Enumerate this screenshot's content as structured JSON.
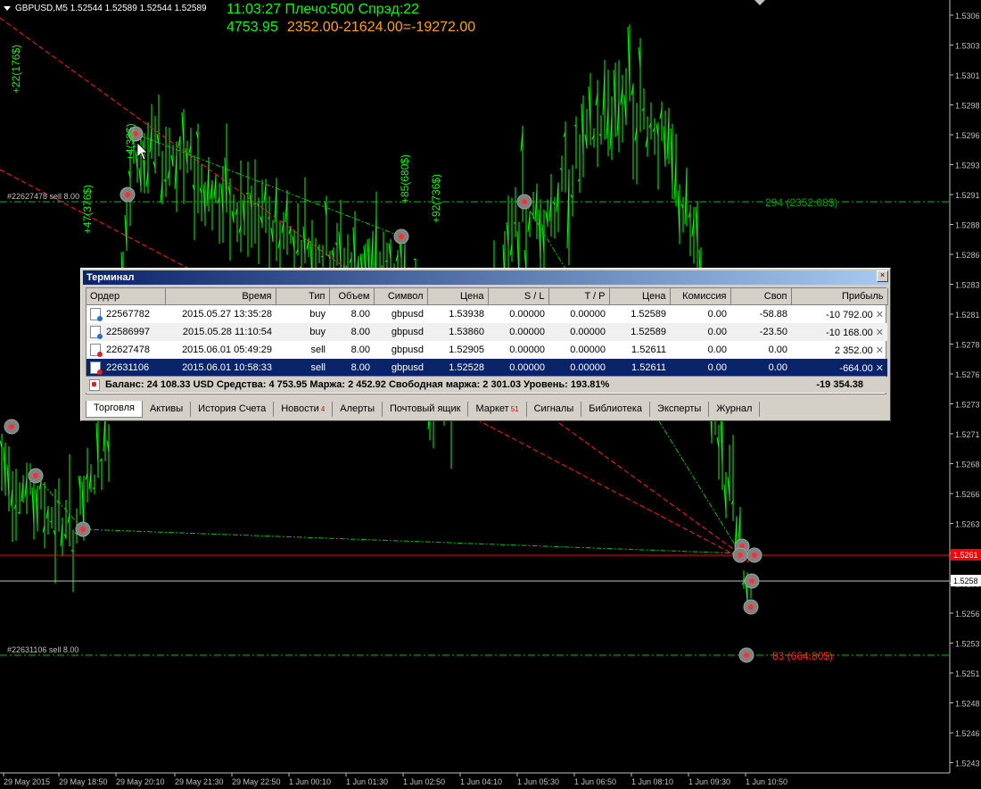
{
  "header": {
    "symbol": "GBPUSD,M5  1.52544 1.52589 1.52544 1.52589",
    "info_line1": "11:03:27 Плечо:500 Спрэд:22",
    "equity": "4753.95",
    "calc": "2352.00-21624.00=-19272.00"
  },
  "chart": {
    "price_labels": [
      "1.5306",
      "1.5303",
      "1.5301",
      "1.5298",
      "1.5296",
      "1.5293",
      "1.5291",
      "1.5288",
      "1.5286",
      "1.5283",
      "1.5281",
      "1.5278",
      "1.5276",
      "1.5273",
      "1.5271",
      "1.5268",
      "1.5266",
      "1.5263",
      "1.5261",
      "1.5258",
      "1.5256",
      "1.5253",
      "1.5251",
      "1.5248",
      "1.5246",
      "1.5243"
    ],
    "time_labels": [
      "29 May 2015",
      "29 May 18:50",
      "29 May 20:10",
      "29 May 21:30",
      "29 May 22:50",
      "1 Jun 00:10",
      "1 Jun 01:30",
      "1 Jun 02:50",
      "1 Jun 04:10",
      "1 Jun 05:30",
      "1 Jun 06:50",
      "1 Jun 08:10",
      "1 Jun 09:30",
      "1 Jun 10:50"
    ],
    "ask_label": "1.5261",
    "bid_label": "1.5258",
    "order_label_top": "#22627478 sell 8.00",
    "order_label_bottom": "#22631106 sell 8.00",
    "profit_label_top": "294 (2352.08$)",
    "profit_label_bottom": "83 (664.80$)",
    "vlabels": [
      "+22(176$)",
      "+4(33$)",
      "+47(376$)",
      "+85(680$)",
      "+92(736$)"
    ],
    "colors": {
      "bars": "#00ff00",
      "ask_line": "#ff0000",
      "bid_line": "#c0c0c0",
      "order_line": "#00c000",
      "loss": "#ff2020"
    }
  },
  "terminal": {
    "title": "Терминал",
    "close": "×",
    "columns": [
      "Ордер",
      "Время",
      "Тип",
      "Объем",
      "Символ",
      "Цена",
      "S / L",
      "T / P",
      "Цена",
      "Комиссия",
      "Своп",
      "Прибыль"
    ],
    "rows": [
      {
        "order": "22567782",
        "time": "2015.05.27 13:35:28",
        "type": "buy",
        "volume": "8.00",
        "symbol": "gbpusd",
        "price": "1.53938",
        "sl": "0.00000",
        "tp": "0.00000",
        "cur": "1.52589",
        "commission": "0.00",
        "swap": "-58.88",
        "profit": "-10 792.00"
      },
      {
        "order": "22586997",
        "time": "2015.05.28 11:10:54",
        "type": "buy",
        "volume": "8.00",
        "symbol": "gbpusd",
        "price": "1.53860",
        "sl": "0.00000",
        "tp": "0.00000",
        "cur": "1.52589",
        "commission": "0.00",
        "swap": "-23.50",
        "profit": "-10 168.00"
      },
      {
        "order": "22627478",
        "time": "2015.06.01 05:49:29",
        "type": "sell",
        "volume": "8.00",
        "symbol": "gbpusd",
        "price": "1.52905",
        "sl": "0.00000",
        "tp": "0.00000",
        "cur": "1.52611",
        "commission": "0.00",
        "swap": "0.00",
        "profit": "2 352.00"
      },
      {
        "order": "22631106",
        "time": "2015.06.01 10:58:33",
        "type": "sell",
        "volume": "8.00",
        "symbol": "gbpusd",
        "price": "1.52528",
        "sl": "0.00000",
        "tp": "0.00000",
        "cur": "1.52611",
        "commission": "0.00",
        "swap": "0.00",
        "profit": "-664.00"
      }
    ],
    "summary": "Баланс: 24 108.33 USD  Средства: 4 753.95  Маржа: 2 452.92  Свободная маржа: 2 301.03  Уровень: 193.81%",
    "total_profit": "-19 354.38",
    "tabs": [
      {
        "label": "Торговля",
        "badge": ""
      },
      {
        "label": "Активы",
        "badge": ""
      },
      {
        "label": "История Счета",
        "badge": ""
      },
      {
        "label": "Новости",
        "badge": "4"
      },
      {
        "label": "Алерты",
        "badge": ""
      },
      {
        "label": "Почтовый ящик",
        "badge": ""
      },
      {
        "label": "Маркет",
        "badge": "51"
      },
      {
        "label": "Сигналы",
        "badge": ""
      },
      {
        "label": "Библиотека",
        "badge": ""
      },
      {
        "label": "Эксперты",
        "badge": ""
      },
      {
        "label": "Журнал",
        "badge": ""
      }
    ]
  }
}
